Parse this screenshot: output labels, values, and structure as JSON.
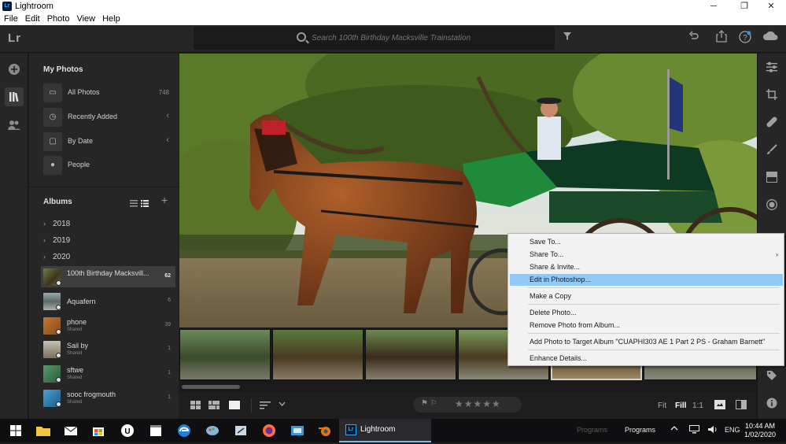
{
  "window": {
    "title": "Lightroom",
    "badge": "Lr",
    "min": "─",
    "max": "❐",
    "close": "✕"
  },
  "menubar": [
    "File",
    "Edit",
    "Photo",
    "View",
    "Help"
  ],
  "toolbar": {
    "logo": "Lr",
    "search_placeholder": "Search 100th Birthday Macksville Trainstation",
    "icons": [
      "filter-icon",
      "undo-icon",
      "share-icon",
      "help-icon",
      "cloud-icon"
    ]
  },
  "left_rail": {
    "icons": [
      "add-icon",
      "library-icon",
      "people-icon"
    ]
  },
  "panel": {
    "my_photos_title": "My Photos",
    "items": [
      {
        "label": "All Photos",
        "count": "748",
        "icon": "photos-icon"
      },
      {
        "label": "Recently Added",
        "chevron": "‹",
        "icon": "clock-icon"
      },
      {
        "label": "By Date",
        "chevron": "‹",
        "icon": "calendar-icon"
      },
      {
        "label": "People",
        "icon": "person-icon"
      }
    ],
    "albums_title": "Albums",
    "years": [
      "2018",
      "2019",
      "2020"
    ],
    "albums": [
      {
        "label": "100th Birthday Macksvill...",
        "count": "62",
        "sub": "",
        "color": "#5a6a3a"
      },
      {
        "label": "Aquafern",
        "count": "6",
        "sub": "",
        "color": "#7a8a8a"
      },
      {
        "label": "phone",
        "count": "39",
        "sub": "Shared",
        "color": "#b06a30"
      },
      {
        "label": "Sail by",
        "count": "1",
        "sub": "Shared",
        "color": "#8a8070"
      },
      {
        "label": "sftwe",
        "count": "1",
        "sub": "Shared",
        "color": "#4a7a5a"
      },
      {
        "label": "sooc frogmouth",
        "count": "1",
        "sub": "Shared",
        "color": "#3a8ab0"
      }
    ]
  },
  "bottombar": {
    "fit": "Fit",
    "fill": "Fill",
    "ratio": "1:1",
    "stars": "★★★★★"
  },
  "right_rail": {
    "icons": [
      "edit-sliders-icon",
      "crop-icon",
      "healing-icon",
      "brush-icon",
      "linear-gradient-icon",
      "radial-gradient-icon",
      "more-icon",
      "tag-icon",
      "info-icon"
    ]
  },
  "context_menu": {
    "items": [
      {
        "label": "Save To...",
        "sub": ""
      },
      {
        "label": "Share To...",
        "sub": "›"
      },
      {
        "label": "Share & Invite...",
        "sub": ""
      },
      {
        "label": "Edit in Photoshop...",
        "sub": "",
        "highlight": true
      },
      {
        "label": "Make a Copy",
        "sub": ""
      },
      {
        "label": "Delete Photo...",
        "sub": ""
      },
      {
        "label": "Remove Photo from Album...",
        "sub": ""
      },
      {
        "label": "Add Photo to Target Album \"CUAPHI303 AE 1 Part 2  PS - Graham Barnett\"",
        "sub": ""
      },
      {
        "label": "Enhance Details...",
        "sub": ""
      }
    ]
  },
  "taskbar": {
    "active_app": "Lightroom",
    "ghost_programs": "Programs",
    "programs": "Programs",
    "lang": "ENG",
    "time": "10:44 AM",
    "date": "1/02/2020"
  }
}
